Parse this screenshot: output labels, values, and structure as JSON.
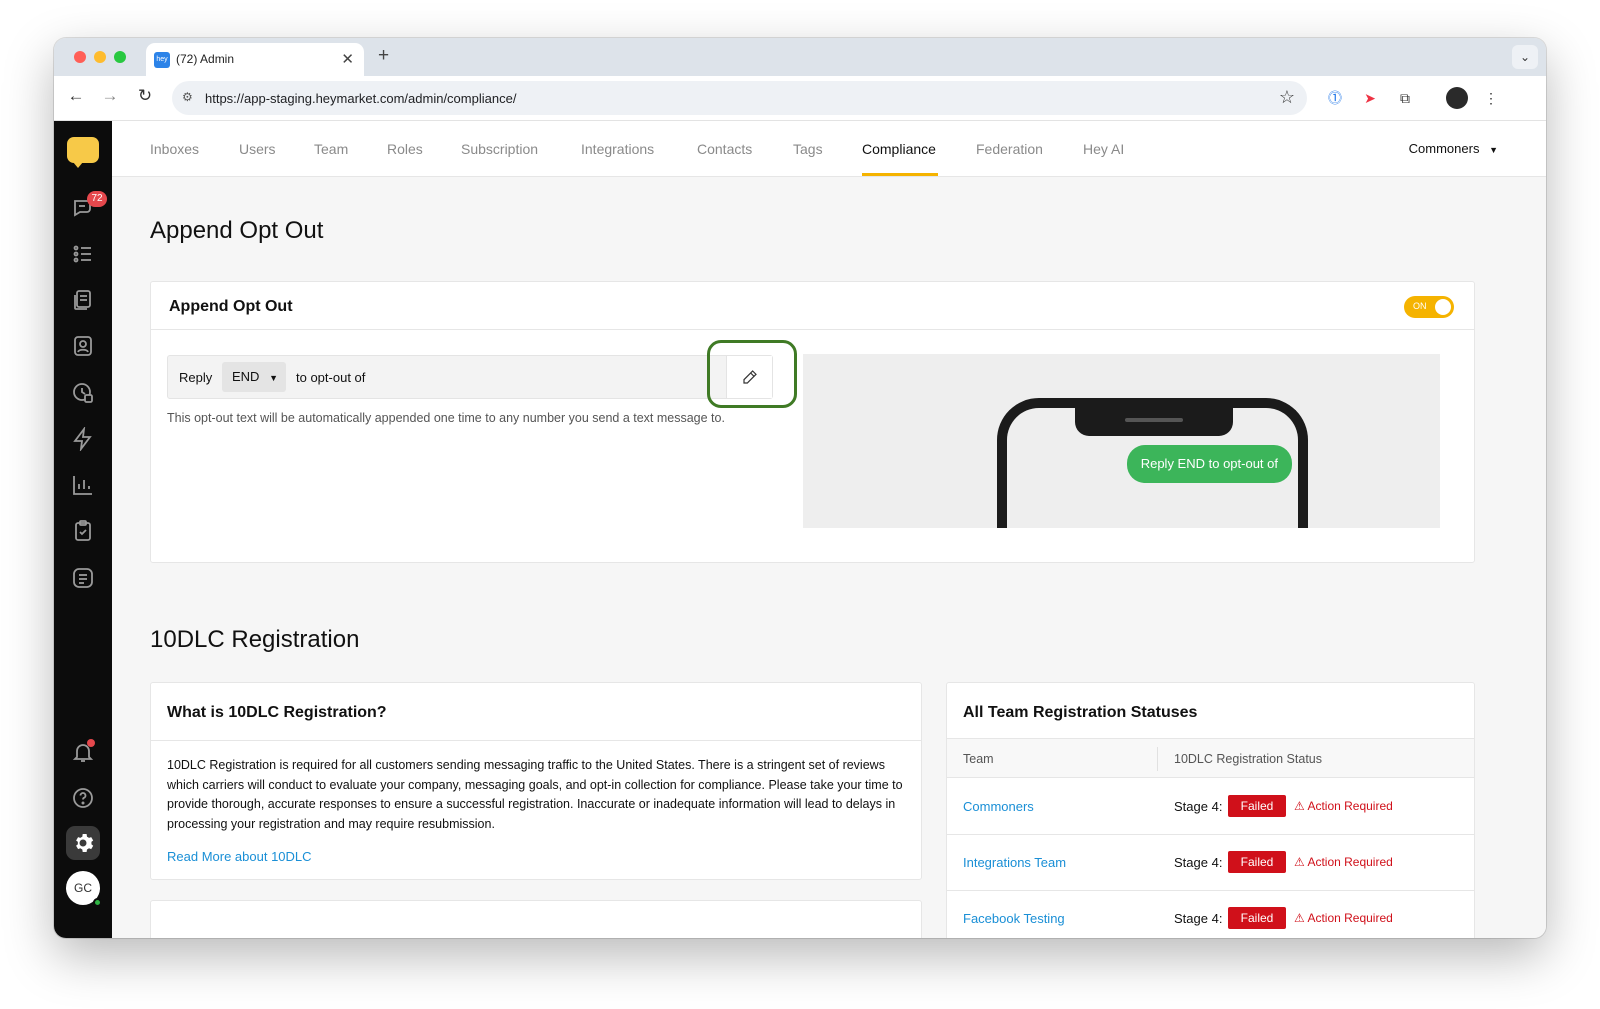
{
  "browser": {
    "tab_title": "(72) Admin",
    "favicon_text": "hey",
    "url": "https://app-staging.heymarket.com/admin/compliance/"
  },
  "sidebar": {
    "unread_count": "72",
    "avatar_initials": "GC"
  },
  "topnav": {
    "items": [
      "Inboxes",
      "Users",
      "Team",
      "Roles",
      "Subscription",
      "Integrations",
      "Contacts",
      "Tags",
      "Compliance",
      "Federation",
      "Hey AI"
    ],
    "active": "Compliance",
    "org": "Commoners"
  },
  "append_opt_out": {
    "heading": "Append Opt Out",
    "card_title": "Append Opt Out",
    "toggle_label": "ON",
    "reply_label": "Reply",
    "keyword": "END",
    "optout_suffix": "to opt-out of",
    "helper_text": "This opt-out text will be automatically appended one time to any number you send a text message to.",
    "preview_message": "Reply END to opt-out of"
  },
  "registration": {
    "heading": "10DLC Registration",
    "info_title": "What is 10DLC Registration?",
    "info_body": "10DLC Registration is required for all customers sending messaging traffic to the United States. There is a stringent set of reviews which carriers will conduct to evaluate your company, messaging goals, and opt-in collection for compliance. Please take your time to provide thorough, accurate responses to ensure a successful registration. Inaccurate or inadequate information will lead to delays in processing your registration and may require resubmission.",
    "read_more": "Read More about 10DLC",
    "statuses_title": "All Team Registration Statuses",
    "columns": [
      "Team",
      "10DLC Registration Status"
    ],
    "rows": [
      {
        "team": "Commoners",
        "stage": "Stage 4:",
        "status": "Failed",
        "action": "Action Required"
      },
      {
        "team": "Integrations Team",
        "stage": "Stage 4:",
        "status": "Failed",
        "action": "Action Required"
      },
      {
        "team": "Facebook Testing",
        "stage": "Stage 4:",
        "status": "Failed",
        "action": "Action Required"
      }
    ]
  },
  "colors": {
    "accent": "#f5b300",
    "link": "#1a8fd6",
    "failed": "#d0101a",
    "bubble": "#3cb55a",
    "highlight": "#3f7a25"
  }
}
